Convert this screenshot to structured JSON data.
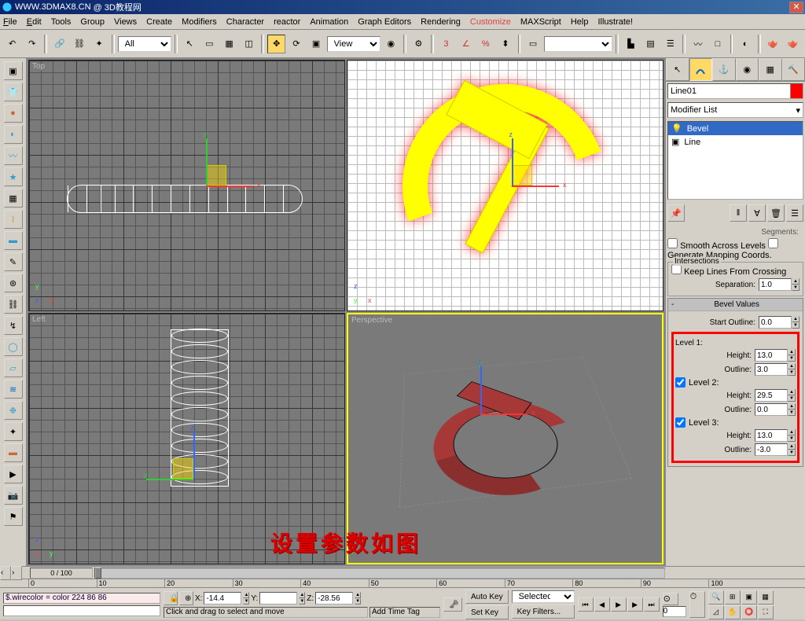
{
  "title": {
    "url": "WWW.3DMAX8.CN",
    "site": "@ 3D教程网"
  },
  "menu": {
    "file": "File",
    "edit": "Edit",
    "tools": "Tools",
    "group": "Group",
    "views": "Views",
    "create": "Create",
    "modifiers": "Modifiers",
    "character": "Character",
    "reactor": "reactor",
    "animation": "Animation",
    "graph": "Graph Editors",
    "rendering": "Rendering",
    "customize": "Customize",
    "maxscript": "MAXScript",
    "help": "Help",
    "illustrate": "Illustrate!"
  },
  "toolbar": {
    "selset": "All",
    "refmode": "View"
  },
  "viewports": {
    "top": "Top",
    "front": "",
    "left": "Left",
    "persp": "Perspective"
  },
  "caption": "设置参数如图",
  "cmdpanel": {
    "objname": "Line01",
    "modlist": "Modifier List",
    "stack": {
      "bevel": "Bevel",
      "line": "Line"
    },
    "segments_label": "Segments:",
    "smooth": "Smooth Across Levels",
    "genmap": "Generate Mapping Coords.",
    "inter_h": "Intersections",
    "keep": "Keep Lines From Crossing",
    "sep_label": "Separation:",
    "sep_val": "1.0",
    "bevel_h": "Bevel Values",
    "start_label": "Start Outline:",
    "start_val": "0.0",
    "l1": "Level 1:",
    "l1h": "Height:",
    "l1h_v": "13.0",
    "l1o": "Outline:",
    "l1o_v": "3.0",
    "l2": "Level 2:",
    "l2h": "Height:",
    "l2h_v": "29.5",
    "l2o": "Outline:",
    "l2o_v": "0.0",
    "l3": "Level 3:",
    "l3h": "Height:",
    "l3h_v": "13.0",
    "l3o": "Outline:",
    "l3o_v": "-3.0"
  },
  "time": {
    "pos": "0 / 100",
    "ticks": [
      "0",
      "10",
      "20",
      "30",
      "40",
      "50",
      "60",
      "70",
      "80",
      "90",
      "100"
    ]
  },
  "status": {
    "listener": "$.wirecolor = color 224 86 86",
    "prompt": "Click and drag to select and move",
    "x": "-14.4",
    "y": "",
    "z": "-28.56",
    "addtag": "Add Time Tag",
    "autokey": "Auto Key",
    "setkey": "Set Key",
    "selected": "Selected",
    "keyfilters": "Key Filters..."
  }
}
